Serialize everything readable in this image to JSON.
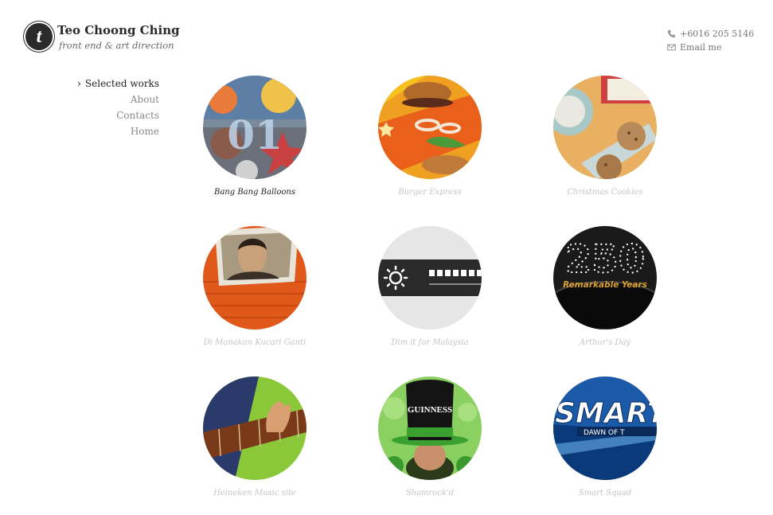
{
  "header": {
    "logo_letter": "t",
    "name": "Teo Choong Ching",
    "tagline": "front end & art direction"
  },
  "contact": {
    "phone": "+6016 205 5146",
    "email_label": "Email me"
  },
  "nav": {
    "items": [
      {
        "label": "Selected works",
        "active": true
      },
      {
        "label": "About",
        "active": false
      },
      {
        "label": "Contacts",
        "active": false
      },
      {
        "label": "Home",
        "active": false
      }
    ]
  },
  "works": [
    {
      "title": "Bang Bang Balloons",
      "active": true
    },
    {
      "title": "Burger Express",
      "active": false
    },
    {
      "title": "Christmas Cookies",
      "active": false
    },
    {
      "title": "Di Manakan Kucari Ganti",
      "active": false
    },
    {
      "title": "Dim it for Malaysia",
      "active": false
    },
    {
      "title": "Arthur's Day",
      "active": false
    },
    {
      "title": "Heineken Music site",
      "active": false
    },
    {
      "title": "Shamrock'd",
      "active": false
    },
    {
      "title": "Smart Squad",
      "active": false
    }
  ],
  "thumb_text": {
    "balloons_number": "01",
    "arthur_number": "250",
    "arthur_subtitle": "Remarkable Years",
    "guinness": "GUINNESS",
    "smart": "SMART",
    "smart_sub": "DAWN OF T"
  },
  "colors": {
    "text_dark": "#222222",
    "text_muted": "#888888",
    "caption_muted": "#c4c4c4"
  }
}
